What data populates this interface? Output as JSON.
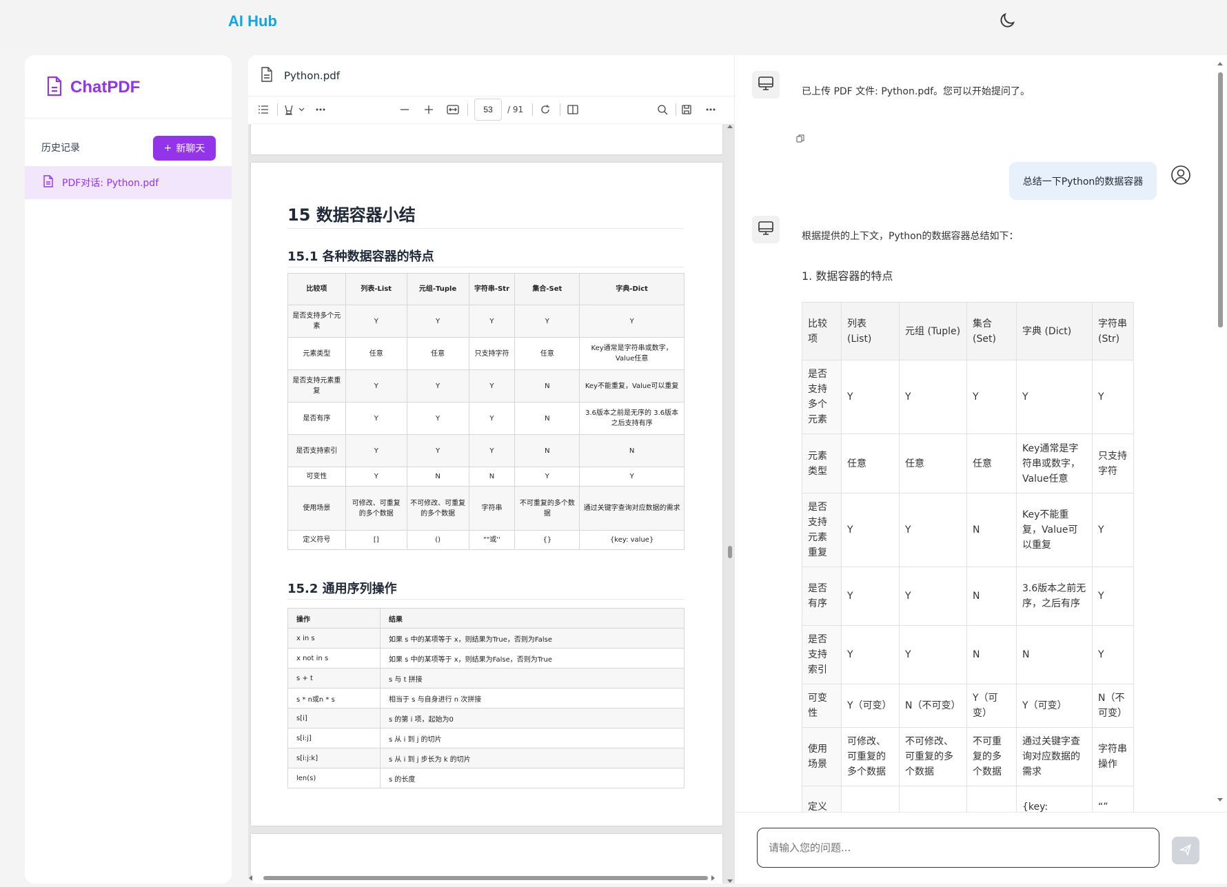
{
  "app": {
    "brand": "AI Hub",
    "theme_icon": "moon-icon"
  },
  "sidebar": {
    "title": "ChatPDF",
    "history_label": "历史记录",
    "new_chat_label": "新聊天",
    "new_chat_icon": "+",
    "items": [
      {
        "label": "PDF对话: Python.pdf"
      }
    ]
  },
  "viewer": {
    "file_name": "Python.pdf",
    "page_current": "53",
    "page_total": "/ 91",
    "heading": "15 数据容器小结",
    "section1": "15.1 各种数据容器的特点",
    "section2": "15.2 通用序列操作",
    "table1": {
      "headers": [
        "比较项",
        "列表-List",
        "元组-Tuple",
        "字符串-Str",
        "集合-Set",
        "字典-Dict"
      ],
      "rows": [
        [
          "是否支持多个元素",
          "Y",
          "Y",
          "Y",
          "Y",
          "Y"
        ],
        [
          "元素类型",
          "任意",
          "任意",
          "只支持字符",
          "任意",
          "Key通常是字符串或数字，Value任意"
        ],
        [
          "是否支持元素重复",
          "Y",
          "Y",
          "Y",
          "N",
          "Key不能重复，Value可以重复"
        ],
        [
          "是否有序",
          "Y",
          "Y",
          "Y",
          "N",
          "3.6版本之前是无序的 3.6版本之后支持有序"
        ],
        [
          "是否支持索引",
          "Y",
          "Y",
          "Y",
          "N",
          "N"
        ],
        [
          "可变性",
          "Y",
          "N",
          "N",
          "Y",
          "Y"
        ],
        [
          "使用场景",
          "可修改、可重复的多个数据",
          "不可修改、可重复的多个数据",
          "字符串",
          "不可重复的多个数据",
          "通过关键字查询对应数据的需求"
        ],
        [
          "定义符号",
          "[]",
          "()",
          "\"\"或''",
          "{}",
          "{key: value}"
        ]
      ]
    },
    "table2": {
      "headers": [
        "操作",
        "结果"
      ],
      "rows": [
        [
          "x in s",
          "如果 s 中的某项等于 x，则结果为True，否则为False"
        ],
        [
          "x not in s",
          "如果 s 中的某项等于 x，则结果为False，否则为True"
        ],
        [
          "s + t",
          "s 与 t 拼接"
        ],
        [
          "s * n或n * s",
          "相当于 s 与自身进行 n 次拼接"
        ],
        [
          "s[i]",
          "s 的第 i 项，起始为0"
        ],
        [
          "s[i:j]",
          "s 从 i 到 j 的切片"
        ],
        [
          "s[i:j:k]",
          "s 从 i 到 j 步长为 k 的切片"
        ],
        [
          "len(s)",
          "s 的长度"
        ]
      ]
    }
  },
  "chat": {
    "system_msg": "已上传 PDF 文件: Python.pdf。您可以开始提问了。",
    "user_msg": "总结一下Python的数据容器",
    "answer_intro": "根据提供的上下文，Python的数据容器总结如下：",
    "answer_section": "1. 数据容器的特点",
    "answer_table": {
      "headers": [
        "比较项",
        "列表 (List)",
        "元组 (Tuple)",
        "集合 (Set)",
        "字典 (Dict)",
        "字符串 (Str)"
      ],
      "rows": [
        [
          "是否支持多个元素",
          "Y",
          "Y",
          "Y",
          "Y",
          "Y"
        ],
        [
          "元素类型",
          "任意",
          "任意",
          "任意",
          "Key通常是字符串或数字，Value任意",
          "只支持字符"
        ],
        [
          "是否支持元素重复",
          "Y",
          "Y",
          "N",
          "Key不能重复，Value可以重复",
          "Y"
        ],
        [
          "是否有序",
          "Y",
          "Y",
          "N",
          "3.6版本之前无序，之后有序",
          "Y"
        ],
        [
          "是否支持索引",
          "Y",
          "Y",
          "N",
          "N",
          "Y"
        ],
        [
          "可变性",
          "Y（可变）",
          "N（不可变）",
          "Y（可变）",
          "Y（可变）",
          "N（不可变）"
        ],
        [
          "使用场景",
          "可修改、可重复的多个数据",
          "不可修改、可重复的多个数据",
          "不可重复的多个数据",
          "通过关键字查询对应数据的需求",
          "字符串操作"
        ],
        [
          "定义",
          "",
          "",
          "",
          "{key:",
          "“”"
        ]
      ]
    },
    "input_placeholder": "请输入您的问题..."
  }
}
